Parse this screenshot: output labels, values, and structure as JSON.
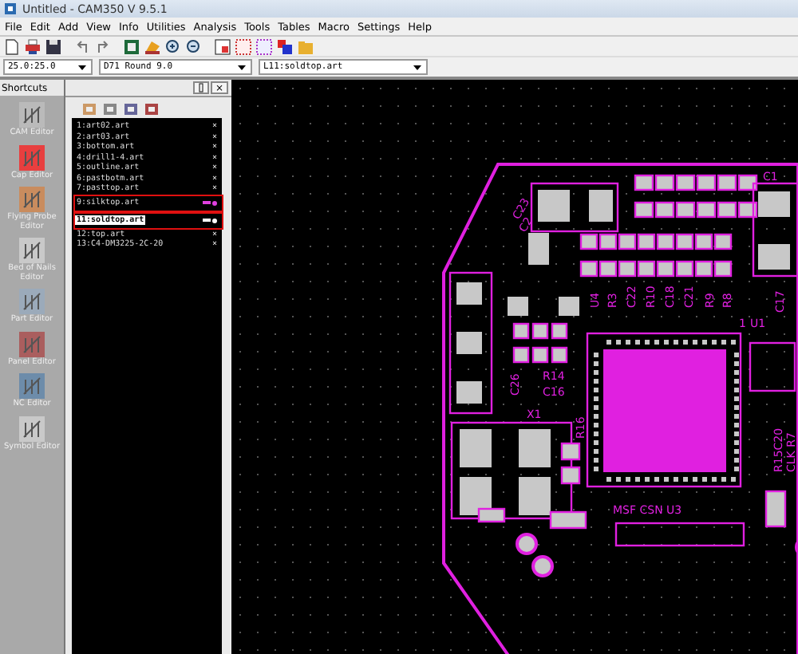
{
  "window": {
    "title": "Untitled - CAM350 V 9.5.1"
  },
  "menu": [
    "File",
    "Edit",
    "Add",
    "View",
    "Info",
    "Utilities",
    "Analysis",
    "Tools",
    "Tables",
    "Macro",
    "Settings",
    "Help"
  ],
  "selectors": [
    {
      "value": "25.0:25.0"
    },
    {
      "value": "D71    Round 9.0"
    },
    {
      "value": "L11:soldtop.art"
    }
  ],
  "shortcuts": {
    "title": "Shortcuts",
    "items": [
      {
        "label": "CAM Editor"
      },
      {
        "label": "Cap Editor"
      },
      {
        "label": "Flying Probe Editor"
      },
      {
        "label": "Bed of Nails Editor"
      },
      {
        "label": "Part Editor"
      },
      {
        "label": "Panel Editor"
      },
      {
        "label": "NC Editor"
      },
      {
        "label": "Symbol Editor"
      }
    ]
  },
  "layers": {
    "close": "×",
    "items": [
      {
        "name": "1:art02.art",
        "mark": "×",
        "selected": false,
        "marked": false
      },
      {
        "name": "2:art03.art",
        "mark": "×",
        "selected": false,
        "marked": false
      },
      {
        "name": "3:bottom.art",
        "mark": "×",
        "selected": false,
        "marked": false
      },
      {
        "name": "4:drill1-4.art",
        "mark": "×",
        "selected": false,
        "marked": false
      },
      {
        "name": "5:outline.art",
        "mark": "×",
        "selected": false,
        "marked": false
      },
      {
        "name": "6:pastbotm.art",
        "mark": "×",
        "selected": false,
        "marked": false
      },
      {
        "name": "7:pasttop.art",
        "mark": "×",
        "selected": false,
        "marked": false
      },
      {
        "name": "9:silktop.art",
        "color": "#e040e0",
        "selected": false,
        "marked": true
      },
      {
        "name": "11:soldtop.art",
        "color": "#ffffff",
        "selected": true,
        "marked": true
      },
      {
        "name": "12:top.art",
        "mark": "×",
        "selected": false,
        "marked": false
      },
      {
        "name": "13:C4-DM3225-2C-20",
        "mark": "×",
        "selected": false,
        "marked": false
      }
    ]
  },
  "board_labels": [
    "C1",
    "C23",
    "C2",
    "U4",
    "R3",
    "C22",
    "R10",
    "C18",
    "C21",
    "R9",
    "R8",
    "1",
    "U1",
    "C17",
    "C26",
    "R14",
    "C16",
    "X1",
    "R16",
    "MSF  CSN  U3",
    "R15C20",
    "CLK R7"
  ]
}
